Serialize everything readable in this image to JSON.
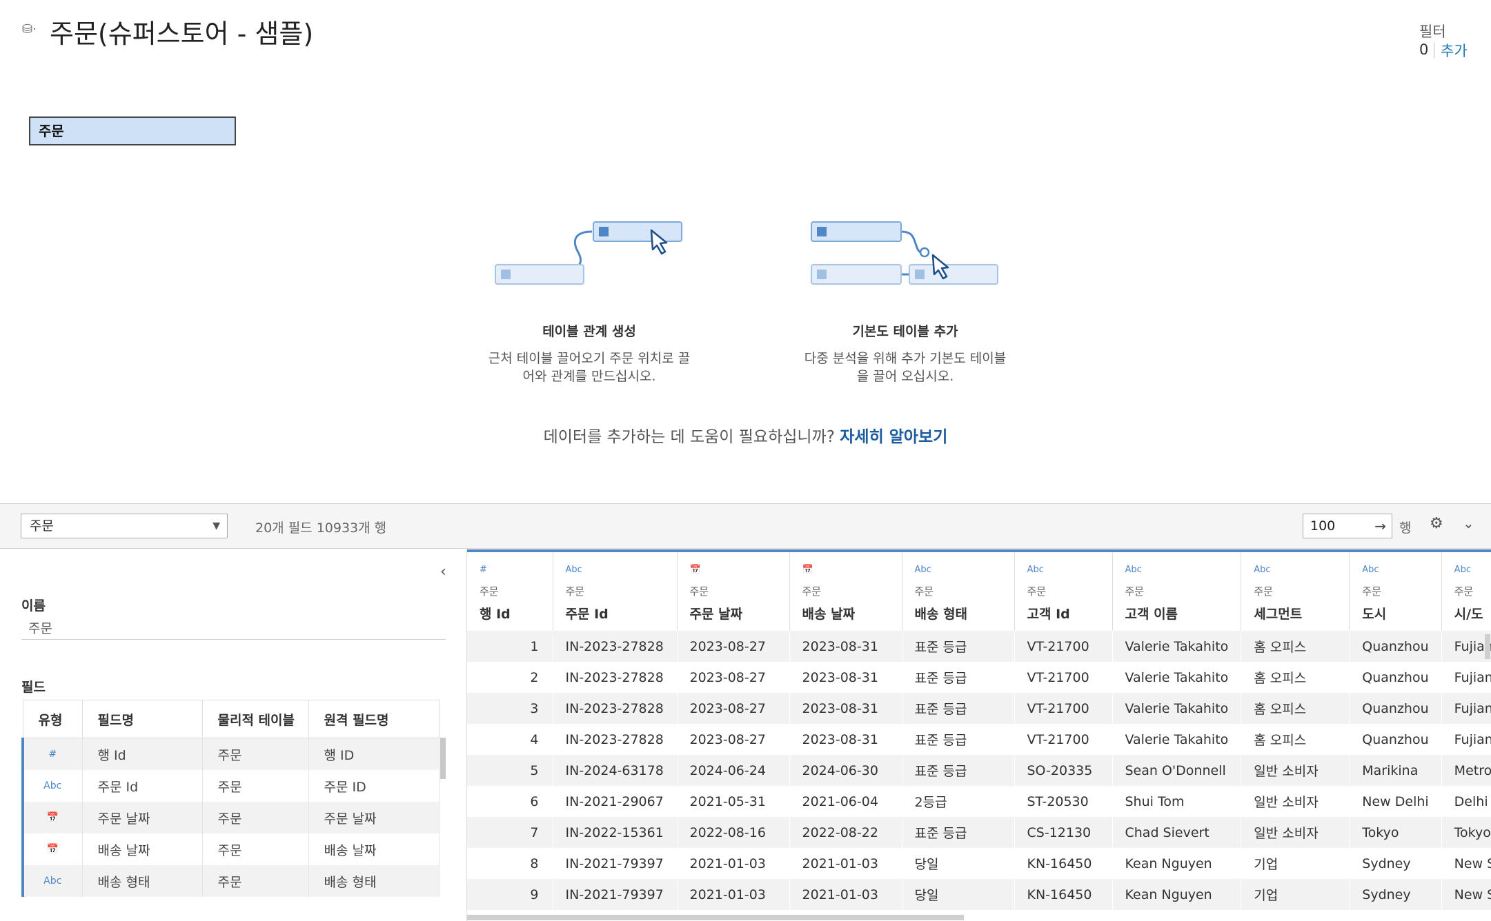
{
  "datasource": {
    "title": "주문(슈퍼스토어 - 샘플)",
    "icon": "database-icon"
  },
  "filters": {
    "label": "필터",
    "count": "0",
    "add_label": "추가"
  },
  "canvas": {
    "table_name": "주문"
  },
  "help": {
    "relation_title": "테이블 관계 생성",
    "relation_text": "근처 테이블 끌어오기 주문 위치로 끌어와 관계를 만드십시오.",
    "base_title": "기본도 테이블 추가",
    "base_text": "다중 분석을 위해 추가 기본도 테이블을 끌어 오십시오.",
    "question": "데이터를 추가하는 데 도움이 필요하십니까?",
    "learn_more": "자세히 알아보기"
  },
  "toolbar": {
    "table_select": "주문",
    "summary": "20개 필드 10933개 행",
    "rows_value": "100",
    "rows_label": "행"
  },
  "meta": {
    "name_label": "이름",
    "name_value": "주문",
    "fields_label": "필드",
    "columns": [
      "유형",
      "필드명",
      "물리적 테이블",
      "원격 필드명"
    ],
    "rows": [
      {
        "type": "#",
        "name": "행 Id",
        "table": "주문",
        "remote": "행 ID"
      },
      {
        "type": "Abc",
        "name": "주문 Id",
        "table": "주문",
        "remote": "주문 ID"
      },
      {
        "type": "📅",
        "name": "주문 날짜",
        "table": "주문",
        "remote": "주문 날짜"
      },
      {
        "type": "📅",
        "name": "배송 날짜",
        "table": "주문",
        "remote": "배송 날짜"
      },
      {
        "type": "Abc",
        "name": "배송 형태",
        "table": "주문",
        "remote": "배송 형태"
      }
    ]
  },
  "grid": {
    "columns": [
      {
        "type": "#",
        "table": "주문",
        "name": "행 Id"
      },
      {
        "type": "Abc",
        "table": "주문",
        "name": "주문 Id"
      },
      {
        "type": "📅",
        "table": "주문",
        "name": "주문 날짜"
      },
      {
        "type": "📅",
        "table": "주문",
        "name": "배송 날짜"
      },
      {
        "type": "Abc",
        "table": "주문",
        "name": "배송 형태"
      },
      {
        "type": "Abc",
        "table": "주문",
        "name": "고객 Id"
      },
      {
        "type": "Abc",
        "table": "주문",
        "name": "고객 이름"
      },
      {
        "type": "Abc",
        "table": "주문",
        "name": "세그먼트"
      },
      {
        "type": "Abc",
        "table": "주문",
        "name": "도시"
      },
      {
        "type": "Abc",
        "table": "주문",
        "name": "시/도"
      }
    ],
    "rows": [
      [
        "1",
        "IN-2023-27828",
        "2023-08-27",
        "2023-08-31",
        "표준 등급",
        "VT-21700",
        "Valerie Takahito",
        "홈 오피스",
        "Quanzhou",
        "Fujian"
      ],
      [
        "2",
        "IN-2023-27828",
        "2023-08-27",
        "2023-08-31",
        "표준 등급",
        "VT-21700",
        "Valerie Takahito",
        "홈 오피스",
        "Quanzhou",
        "Fujian"
      ],
      [
        "3",
        "IN-2023-27828",
        "2023-08-27",
        "2023-08-31",
        "표준 등급",
        "VT-21700",
        "Valerie Takahito",
        "홈 오피스",
        "Quanzhou",
        "Fujian"
      ],
      [
        "4",
        "IN-2023-27828",
        "2023-08-27",
        "2023-08-31",
        "표준 등급",
        "VT-21700",
        "Valerie Takahito",
        "홈 오피스",
        "Quanzhou",
        "Fujian"
      ],
      [
        "5",
        "IN-2024-63178",
        "2024-06-24",
        "2024-06-30",
        "표준 등급",
        "SO-20335",
        "Sean O'Donnell",
        "일반 소비자",
        "Marikina",
        "Metro Manila"
      ],
      [
        "6",
        "IN-2021-29067",
        "2021-05-31",
        "2021-06-04",
        "2등급",
        "ST-20530",
        "Shui Tom",
        "일반 소비자",
        "New Delhi",
        "Delhi"
      ],
      [
        "7",
        "IN-2022-15361",
        "2022-08-16",
        "2022-08-22",
        "표준 등급",
        "CS-12130",
        "Chad Sievert",
        "일반 소비자",
        "Tokyo",
        "Tokyo"
      ],
      [
        "8",
        "IN-2021-79397",
        "2021-01-03",
        "2021-01-03",
        "당일",
        "KN-16450",
        "Kean Nguyen",
        "기업",
        "Sydney",
        "New South Wal"
      ],
      [
        "9",
        "IN-2021-79397",
        "2021-01-03",
        "2021-01-03",
        "당일",
        "KN-16450",
        "Kean Nguyen",
        "기업",
        "Sydney",
        "New South Wal"
      ]
    ]
  }
}
